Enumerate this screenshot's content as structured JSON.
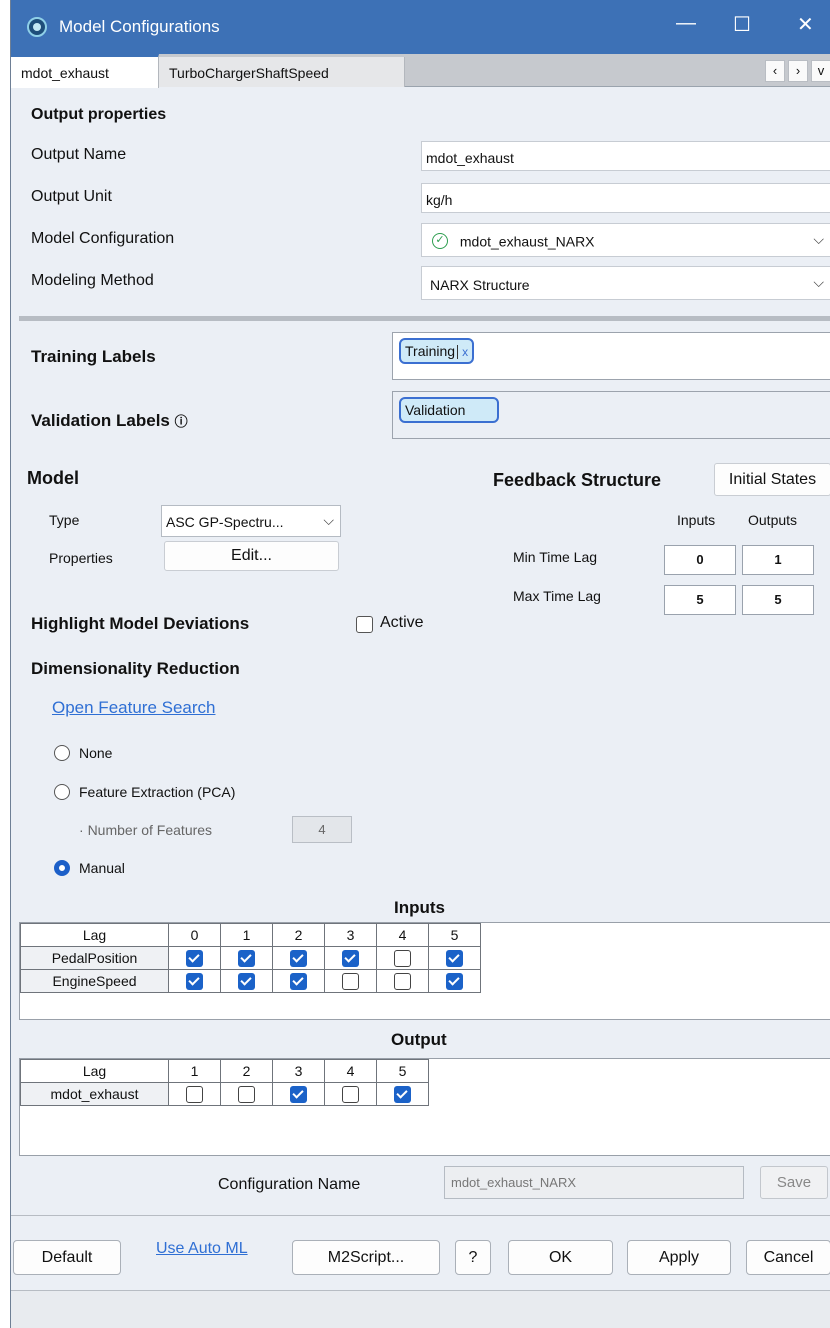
{
  "window": {
    "title": "Model Configurations",
    "controls": {
      "minimize": "—",
      "maximize": "☐",
      "close": "✕"
    }
  },
  "tabs": [
    {
      "label": "mdot_exhaust",
      "active": true
    },
    {
      "label": "TurboChargerShaftSpeed",
      "active": false
    }
  ],
  "tab_nav": {
    "prev": "‹",
    "next": "›",
    "more": "v"
  },
  "output_properties": {
    "heading": "Output properties",
    "output_name_label": "Output Name",
    "output_name_value": "mdot_exhaust",
    "output_unit_label": "Output Unit",
    "output_unit_value": "kg/h",
    "model_config_label": "Model Configuration",
    "model_config_value": "mdot_exhaust_NARX",
    "modeling_method_label": "Modeling Method",
    "modeling_method_value": "NARX Structure"
  },
  "labels": {
    "training_label": "Training Labels",
    "training_chip": "Training",
    "training_chip_remove": "x",
    "validation_label": "Validation Labels",
    "validation_info": "ⓘ",
    "validation_chip": "Validation"
  },
  "model": {
    "heading": "Model",
    "type_label": "Type",
    "type_value": "ASC GP-Spectru...",
    "properties_label": "Properties",
    "edit_button": "Edit..."
  },
  "feedback": {
    "heading": "Feedback Structure",
    "initial_states_button": "Initial States",
    "col_inputs": "Inputs",
    "col_outputs": "Outputs",
    "min_lag_label": "Min Time Lag",
    "max_lag_label": "Max Time Lag",
    "min_inputs": "0",
    "min_outputs": "1",
    "max_inputs": "5",
    "max_outputs": "5"
  },
  "highlight": {
    "label": "Highlight Model Deviations",
    "active_label": "Active",
    "active_checked": false
  },
  "dim_reduction": {
    "heading": "Dimensionality Reduction",
    "feature_search_link": "Open Feature Search",
    "option_none": "None",
    "option_pca": "Feature Extraction (PCA)",
    "num_features_label": "Number of Features",
    "num_features_value": "4",
    "option_manual": "Manual",
    "selected": "Manual"
  },
  "inputs_grid": {
    "title": "Inputs",
    "lag_header": "Lag",
    "lags": [
      "0",
      "1",
      "2",
      "3",
      "4",
      "5"
    ],
    "rows": [
      {
        "name": "PedalPosition",
        "checked": [
          true,
          true,
          true,
          true,
          false,
          true
        ]
      },
      {
        "name": "EngineSpeed",
        "checked": [
          true,
          true,
          true,
          false,
          false,
          true
        ]
      }
    ]
  },
  "output_grid": {
    "title": "Output",
    "lag_header": "Lag",
    "lags": [
      "1",
      "2",
      "3",
      "4",
      "5"
    ],
    "rows": [
      {
        "name": "mdot_exhaust",
        "checked": [
          false,
          false,
          true,
          false,
          true
        ]
      }
    ]
  },
  "config_name": {
    "label": "Configuration Name",
    "value": "mdot_exhaust_NARX",
    "save_button": "Save"
  },
  "footer": {
    "default_button": "Default",
    "auto_ml_link": "Use Auto ML",
    "m2script_button": "M2Script...",
    "help_button": "?",
    "ok_button": "OK",
    "apply_button": "Apply",
    "cancel_button": "Cancel"
  },
  "colors": {
    "title_bar": "#3d71b6",
    "accent_blue": "#1b62c8",
    "link": "#2f6fd4",
    "window_bg": "#ebeff5"
  },
  "icons": {
    "app": "app-logo-icon",
    "model_config_ok": "check-circle-icon",
    "dropdown": "chevron-down-icon"
  }
}
